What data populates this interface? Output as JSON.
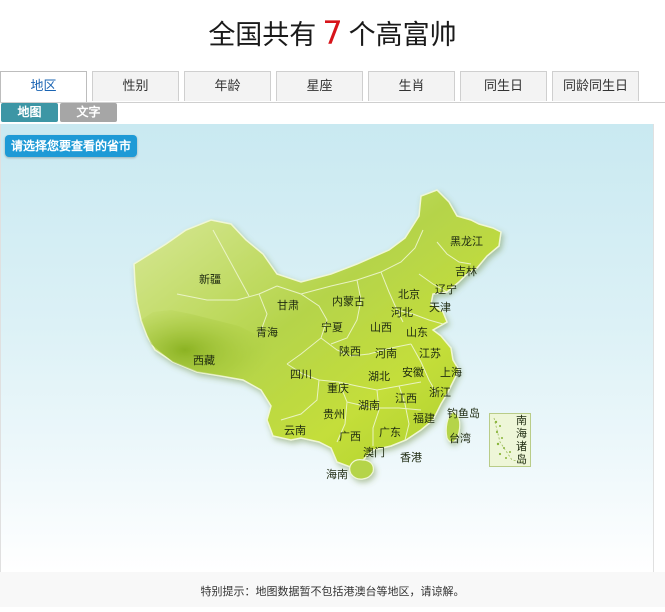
{
  "headline": {
    "prefix": "全国共有",
    "count": "7",
    "suffix": "个高富帅"
  },
  "tabs": [
    {
      "label": "地区",
      "active": true
    },
    {
      "label": "性别"
    },
    {
      "label": "年龄"
    },
    {
      "label": "星座"
    },
    {
      "label": "生肖"
    },
    {
      "label": "同生日"
    },
    {
      "label": "同龄同生日"
    }
  ],
  "subtabs": [
    {
      "label": "地图",
      "active": true
    },
    {
      "label": "文字"
    }
  ],
  "map": {
    "select_label": "请选择您要查看的省市",
    "provinces": [
      "黑龙江",
      "吉林",
      "辽宁",
      "内蒙古",
      "北京",
      "天津",
      "河北",
      "新疆",
      "甘肃",
      "宁夏",
      "山西",
      "山东",
      "青海",
      "陕西",
      "河南",
      "江苏",
      "西藏",
      "四川",
      "湖北",
      "安徽",
      "上海",
      "重庆",
      "浙江",
      "湖南",
      "江西",
      "贵州",
      "福建",
      "钓鱼岛",
      "云南",
      "广西",
      "广东",
      "台湾",
      "澳门",
      "香港",
      "海南"
    ],
    "south_china_sea": "南海诸岛",
    "colors": {
      "land_light": "#dbeaa0",
      "land_mid": "#b5d44a",
      "land_dark": "#86b21d",
      "border": "#eef6cf"
    }
  },
  "footer": {
    "note": "特别提示：地图数据暂不包括港澳台等地区，请谅解。"
  }
}
